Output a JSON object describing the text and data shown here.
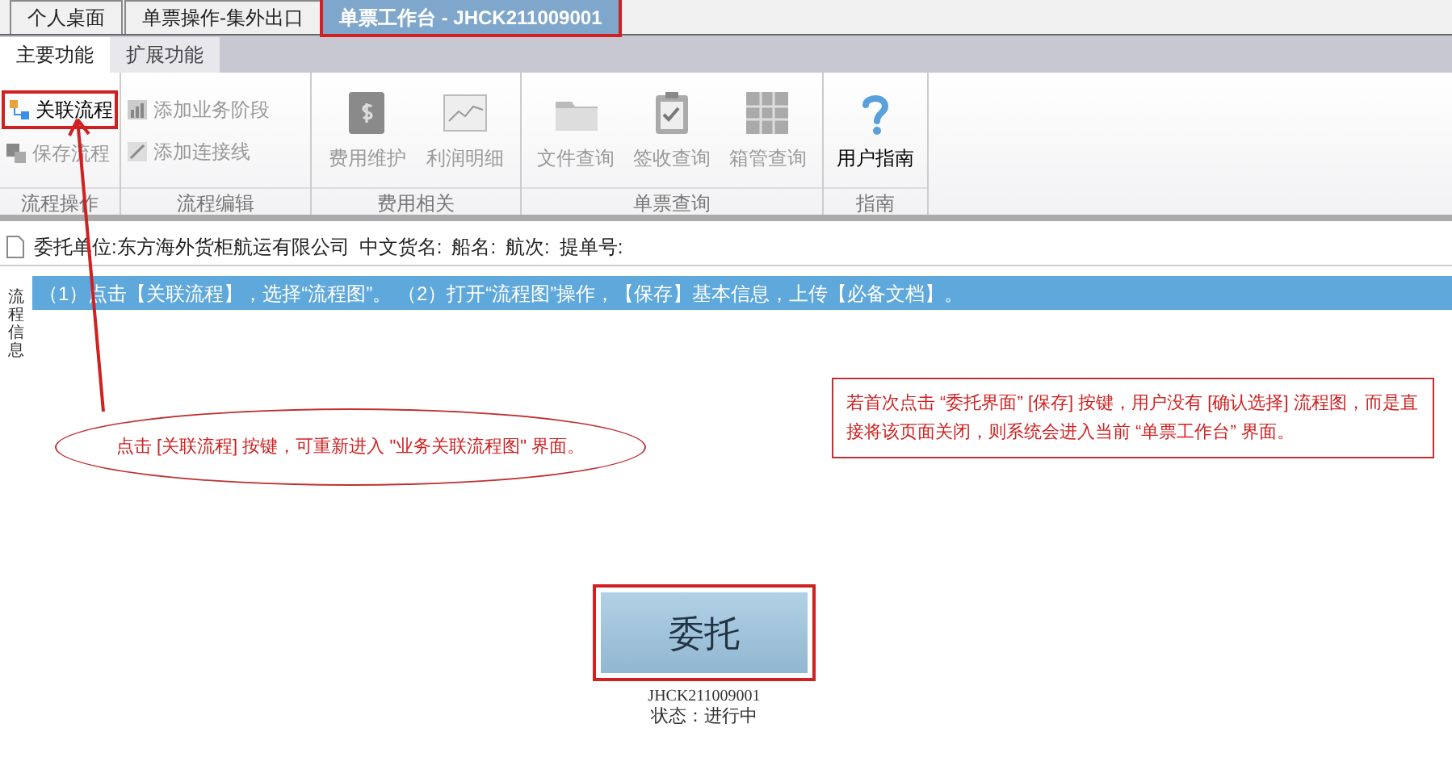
{
  "top_tabs": [
    {
      "label": "个人桌面",
      "selected": false,
      "highlighted": false
    },
    {
      "label": "单票操作-集外出口",
      "selected": false,
      "highlighted": false
    },
    {
      "label": "单票工作台 - JHCK211009001",
      "selected": true,
      "highlighted": true
    }
  ],
  "ribbon": {
    "tabs": [
      {
        "label": "主要功能",
        "selected": true
      },
      {
        "label": "扩展功能",
        "selected": false
      }
    ],
    "groups": [
      {
        "title": "流程操作",
        "kind": "small",
        "buttons": [
          {
            "label": "关联流程",
            "disabled": false,
            "highlighted": true
          },
          {
            "label": "保存流程",
            "disabled": true,
            "highlighted": false
          }
        ]
      },
      {
        "title": "流程编辑",
        "kind": "small",
        "buttons": [
          {
            "label": "添加业务阶段",
            "disabled": true,
            "highlighted": false
          },
          {
            "label": "添加连接线",
            "disabled": true,
            "highlighted": false
          }
        ]
      },
      {
        "title": "费用相关",
        "kind": "large",
        "buttons": [
          {
            "label": "费用维护",
            "disabled": true,
            "highlighted": false
          },
          {
            "label": "利润明细",
            "disabled": true,
            "highlighted": false
          }
        ]
      },
      {
        "title": "单票查询",
        "kind": "large",
        "buttons": [
          {
            "label": "文件查询",
            "disabled": true,
            "highlighted": false
          },
          {
            "label": "签收查询",
            "disabled": true,
            "highlighted": false
          },
          {
            "label": "箱管查询",
            "disabled": true,
            "highlighted": false
          }
        ]
      },
      {
        "title": "指南",
        "kind": "large",
        "buttons": [
          {
            "label": "用户指南",
            "disabled": false,
            "highlighted": false
          }
        ]
      }
    ]
  },
  "info_bar": [
    "委托单位:东方海外货柜航运有限公司",
    "中文货名:",
    "船名:",
    "航次:",
    "提单号:"
  ],
  "instruction": "（1）点击【关联流程】，选择“流程图”。 （2）打开“流程图”操作，【保存】基本信息，上传【必备文档】。",
  "side_panel": {
    "label": "流程信息"
  },
  "annotations": [
    {
      "kind": "ellipse",
      "text": "点击 [关联流程] 按键，可重新进入 \"业务关联流程图\" 界面。"
    },
    {
      "kind": "box",
      "text": "若首次点击 “委托界面” [保存] 按键，用户没有 [确认选择] 流程图，而是直接将该页面关闭，则系统会进入当前 “单票工作台” 界面。"
    }
  ],
  "flow_node": {
    "label": "委托",
    "id": "JHCK211009001",
    "status": "状态：进行中",
    "highlighted": true
  }
}
